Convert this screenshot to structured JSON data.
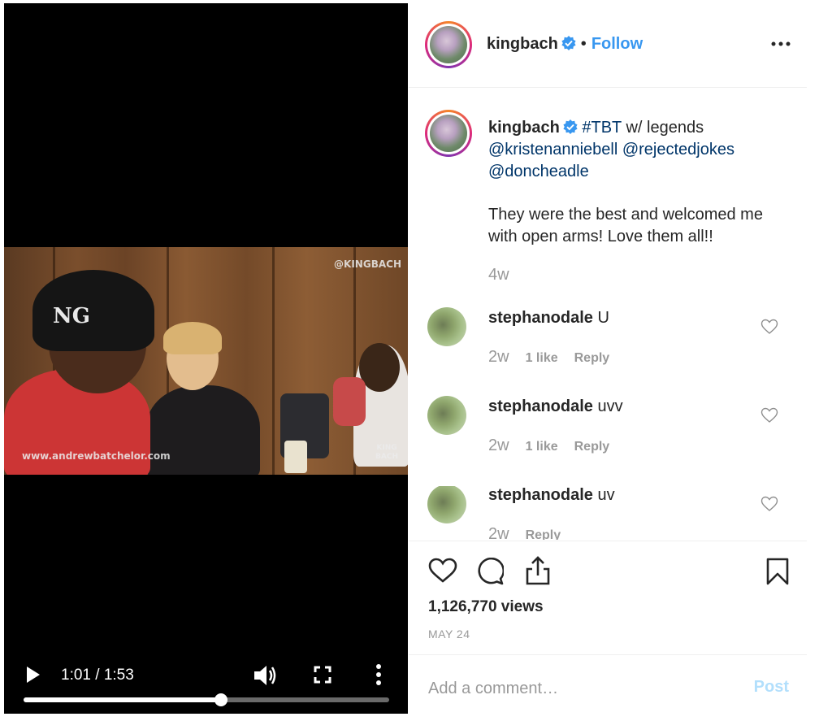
{
  "video": {
    "watermark_top": "@KINGBACH",
    "watermark_bottom": "www.andrewbatchelor.com",
    "corner_logo": "KING BACH",
    "cap_text": "NG",
    "time_display": "1:01 / 1:53",
    "progress_fraction": 0.54,
    "icons": {
      "play": "play-icon",
      "volume": "volume-icon",
      "fullscreen": "fullscreen-icon",
      "more": "more-vertical-icon"
    }
  },
  "header": {
    "username": "kingbach",
    "separator": "•",
    "follow_label": "Follow",
    "more_icon": "more-horizontal-icon"
  },
  "caption": {
    "username": "kingbach",
    "hashtag": "#TBT",
    "text_after_hashtag": " w/ legends",
    "mention_1": "@kristenanniebell",
    "mention_2": "@rejectedjokes",
    "mention_3": "@doncheadle",
    "body": "They were the best and welcomed me with open arms! Love them all!!",
    "age": "4w"
  },
  "comments": [
    {
      "username": "stephanodale",
      "text": "U",
      "age": "2w",
      "likes": "1 like",
      "reply": "Reply"
    },
    {
      "username": "stephanodale",
      "text": "uvv",
      "age": "2w",
      "likes": "1 like",
      "reply": "Reply"
    },
    {
      "username": "stephanodale",
      "text": "uv",
      "age": "2w",
      "likes": "",
      "reply": "Reply"
    }
  ],
  "actions": {
    "icons": [
      "heart-icon",
      "comment-icon",
      "share-icon",
      "bookmark-icon"
    ],
    "views": "1,126,770 views",
    "date": "MAY 24"
  },
  "add_comment": {
    "placeholder": "Add a comment…",
    "post_label": "Post"
  },
  "colors": {
    "link": "#003569",
    "follow": "#3897f0",
    "post_disabled": "#b2dffc",
    "muted": "#999999"
  }
}
